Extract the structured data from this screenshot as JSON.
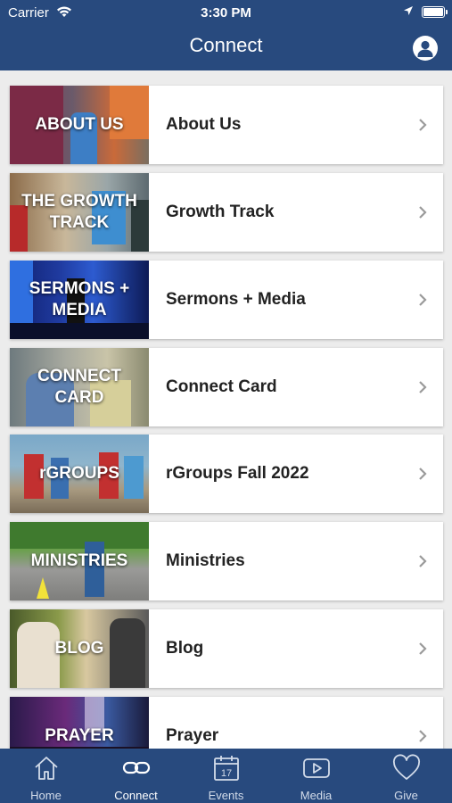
{
  "status_bar": {
    "carrier": "Carrier",
    "time": "3:30 PM"
  },
  "nav": {
    "title": "Connect"
  },
  "items": [
    {
      "thumb_caption": "ABOUT US",
      "label": "About Us"
    },
    {
      "thumb_caption": "THE GROWTH TRACK",
      "label": "Growth Track"
    },
    {
      "thumb_caption": "SERMONS + MEDIA",
      "label": "Sermons + Media"
    },
    {
      "thumb_caption": "CONNECT CARD",
      "label": "Connect Card"
    },
    {
      "thumb_caption": "rGROUPS",
      "label": "rGroups Fall 2022"
    },
    {
      "thumb_caption": "MINISTRIES",
      "label": "Ministries"
    },
    {
      "thumb_caption": "BLOG",
      "label": "Blog"
    },
    {
      "thumb_caption": "PRAYER",
      "label": "Prayer"
    }
  ],
  "tabs": [
    {
      "label": "Home",
      "icon": "home-icon"
    },
    {
      "label": "Connect",
      "icon": "link-icon",
      "active": true
    },
    {
      "label": "Events",
      "icon": "calendar-icon",
      "icon_text": "17"
    },
    {
      "label": "Media",
      "icon": "play-icon"
    },
    {
      "label": "Give",
      "icon": "heart-icon"
    }
  ],
  "colors": {
    "bar": "#284a7e",
    "background": "#ececec",
    "chevron": "#9a9a9a"
  }
}
